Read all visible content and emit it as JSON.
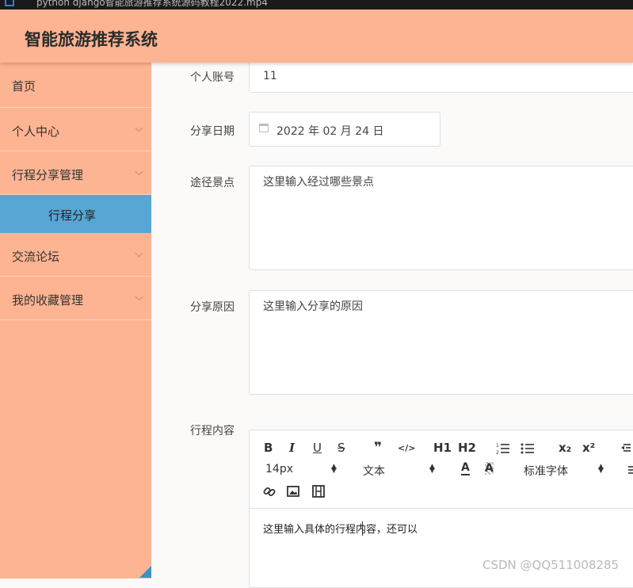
{
  "window": {
    "title": "python django智能旅游推荐系统源码教程2022.mp4"
  },
  "header": {
    "app_title": "智能旅游推荐系统"
  },
  "sidebar": {
    "items": [
      {
        "label": "首页"
      },
      {
        "label": "个人中心"
      },
      {
        "label": "行程分享管理",
        "submenu": [
          {
            "label": "行程分享"
          }
        ]
      },
      {
        "label": "交流论坛"
      },
      {
        "label": "我的收藏管理"
      }
    ]
  },
  "form": {
    "account": {
      "label": "个人账号",
      "value": "11"
    },
    "share_date": {
      "label": "分享日期",
      "value": "2022 年 02 月 24 日"
    },
    "route_spots": {
      "label": "途径景点",
      "placeholder": "这里输入经过哪些景点"
    },
    "share_reason": {
      "label": "分享原因",
      "placeholder": "这里输入分享的原因"
    },
    "itinerary_content": {
      "label": "行程内容",
      "editor_text": "这里输入具体的行程内容，还可以",
      "toolbar": {
        "buttons": [
          "B",
          "I",
          "U",
          "S",
          "❞",
          "</>",
          "H1",
          "H2",
          "ordered-list",
          "bullet-list",
          "x₂",
          "x²"
        ],
        "font_size": "14px",
        "text_format": "文本",
        "font_family": "标准字体"
      }
    }
  },
  "watermark": "CSDN @QQ511008285",
  "colors": {
    "header_bg": "#fdb492",
    "sidebar_bg": "#fdb492",
    "active_submenu": "#57a6d3",
    "content_bg": "#fbfaf8"
  }
}
